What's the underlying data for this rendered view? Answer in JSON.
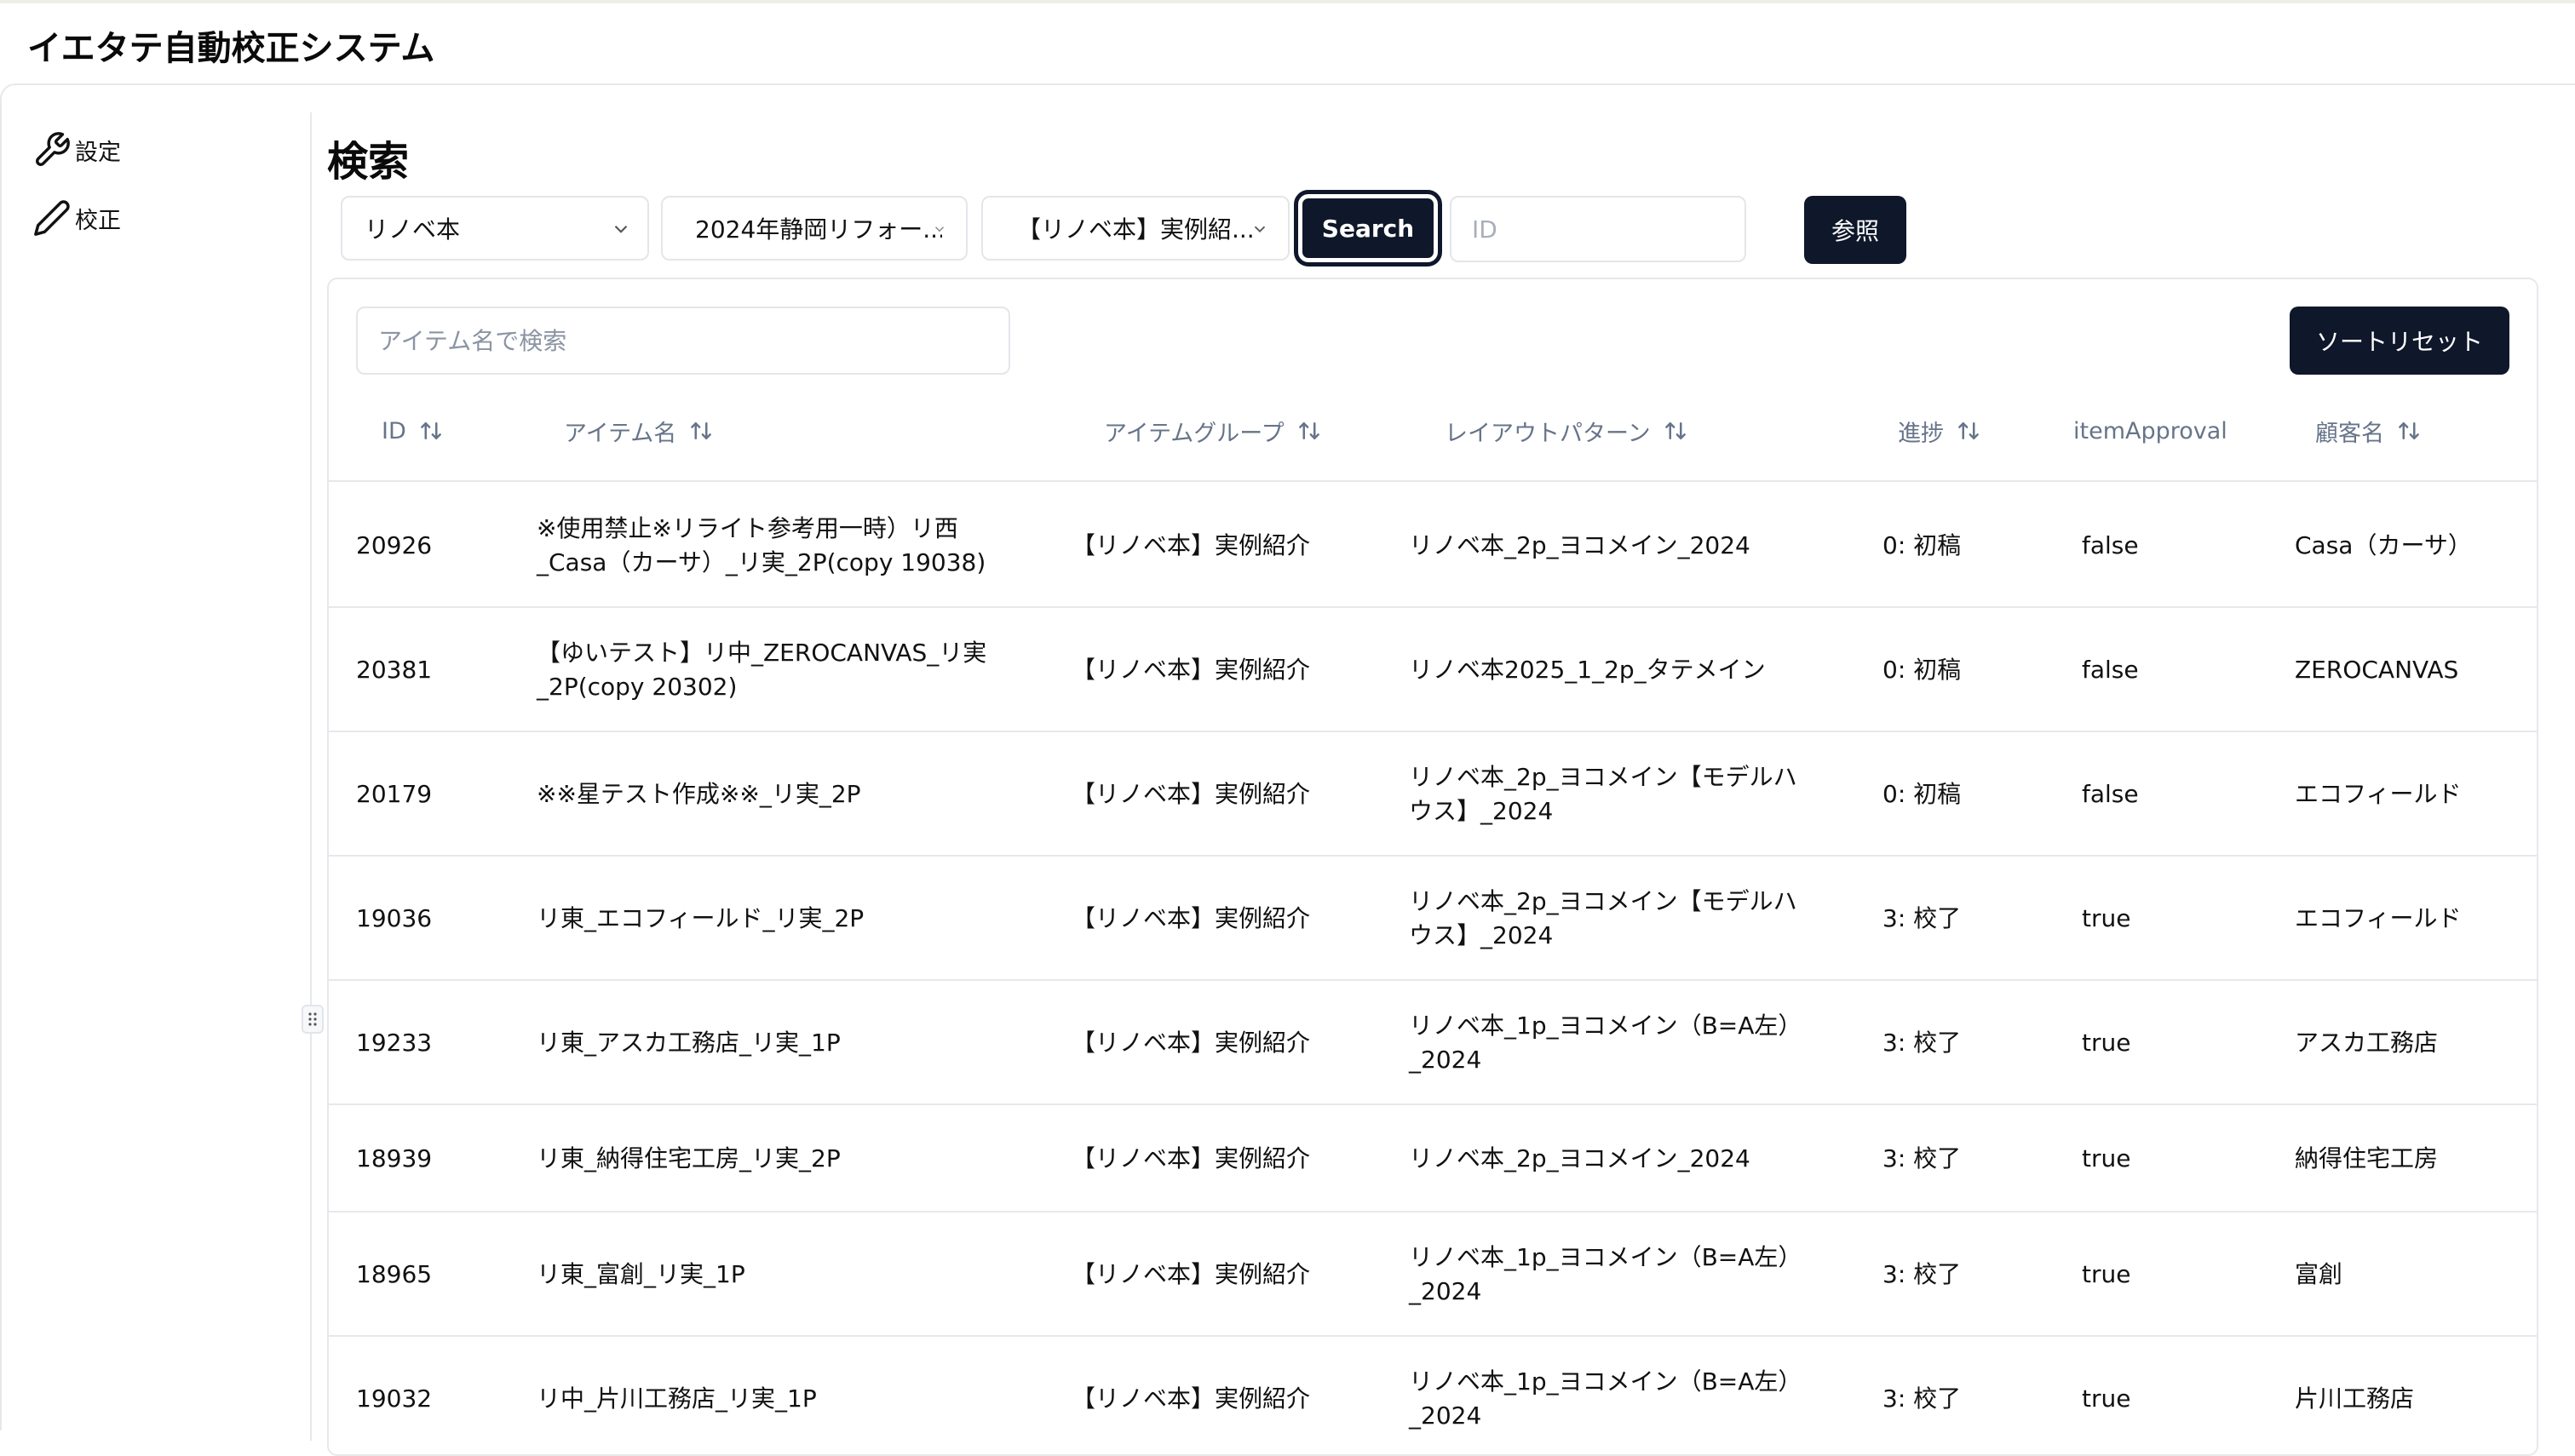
{
  "app": {
    "title": "イエタテ自動校正システム"
  },
  "sidebar": {
    "items": [
      {
        "label": "設定",
        "icon": "wrench-icon"
      },
      {
        "label": "校正",
        "icon": "pencil-icon"
      }
    ]
  },
  "page": {
    "title": "検索"
  },
  "filters": {
    "select1": "リノベ本",
    "select2": "2024年静岡リフォー...",
    "select3": "【リノベ本】実例紹...",
    "search_label": "Search",
    "id_placeholder": "ID",
    "ref_label": "参照"
  },
  "table_tools": {
    "item_search_placeholder": "アイテム名で検索",
    "reset_label": "ソートリセット"
  },
  "columns": [
    "ID",
    "アイテム名",
    "アイテムグループ",
    "レイアウトパターン",
    "進捗",
    "itemApproval",
    "顧客名"
  ],
  "rows": [
    {
      "id": "20926",
      "name": [
        "※使用禁止※リライト参考用一時）リ西",
        "_Casa（カーサ）_リ実_2P(copy 19038)"
      ],
      "group": "【リノベ本】実例紹介",
      "layout": [
        "リノベ本_2p_ヨコメイン_2024"
      ],
      "progress": "0: 初稿",
      "approval": "false",
      "customer": "Casa（カーサ）"
    },
    {
      "id": "20381",
      "name": [
        "【ゆいテスト】リ中_ZEROCANVAS_リ実",
        "_2P(copy 20302)"
      ],
      "group": "【リノベ本】実例紹介",
      "layout": [
        "リノベ本2025_1_2p_タテメイン"
      ],
      "progress": "0: 初稿",
      "approval": "false",
      "customer": "ZEROCANVAS"
    },
    {
      "id": "20179",
      "name": [
        "※※星テスト作成※※_リ実_2P"
      ],
      "group": "【リノベ本】実例紹介",
      "layout": [
        "リノベ本_2p_ヨコメイン【モデルハ",
        "ウス】_2024"
      ],
      "progress": "0: 初稿",
      "approval": "false",
      "customer": "エコフィールド"
    },
    {
      "id": "19036",
      "name": [
        "リ東_エコフィールド_リ実_2P"
      ],
      "group": "【リノベ本】実例紹介",
      "layout": [
        "リノベ本_2p_ヨコメイン【モデルハ",
        "ウス】_2024"
      ],
      "progress": "3: 校了",
      "approval": "true",
      "customer": "エコフィールド"
    },
    {
      "id": "19233",
      "name": [
        "リ東_アスカ工務店_リ実_1P"
      ],
      "group": "【リノベ本】実例紹介",
      "layout": [
        "リノベ本_1p_ヨコメイン（B=A左）",
        "_2024"
      ],
      "progress": "3: 校了",
      "approval": "true",
      "customer": "アスカ工務店"
    },
    {
      "id": "18939",
      "name": [
        "リ東_納得住宅工房_リ実_2P"
      ],
      "group": "【リノベ本】実例紹介",
      "layout": [
        "リノベ本_2p_ヨコメイン_2024"
      ],
      "progress": "3: 校了",
      "approval": "true",
      "customer": "納得住宅工房"
    },
    {
      "id": "18965",
      "name": [
        "リ東_富創_リ実_1P"
      ],
      "group": "【リノベ本】実例紹介",
      "layout": [
        "リノベ本_1p_ヨコメイン（B=A左）",
        "_2024"
      ],
      "progress": "3: 校了",
      "approval": "true",
      "customer": "富創"
    },
    {
      "id": "19032",
      "name": [
        "リ中_片川工務店_リ実_1P"
      ],
      "group": "【リノベ本】実例紹介",
      "layout": [
        "リノベ本_1p_ヨコメイン（B=A左）",
        "_2024"
      ],
      "progress": "3: 校了",
      "approval": "true",
      "customer": "片川工務店"
    }
  ]
}
